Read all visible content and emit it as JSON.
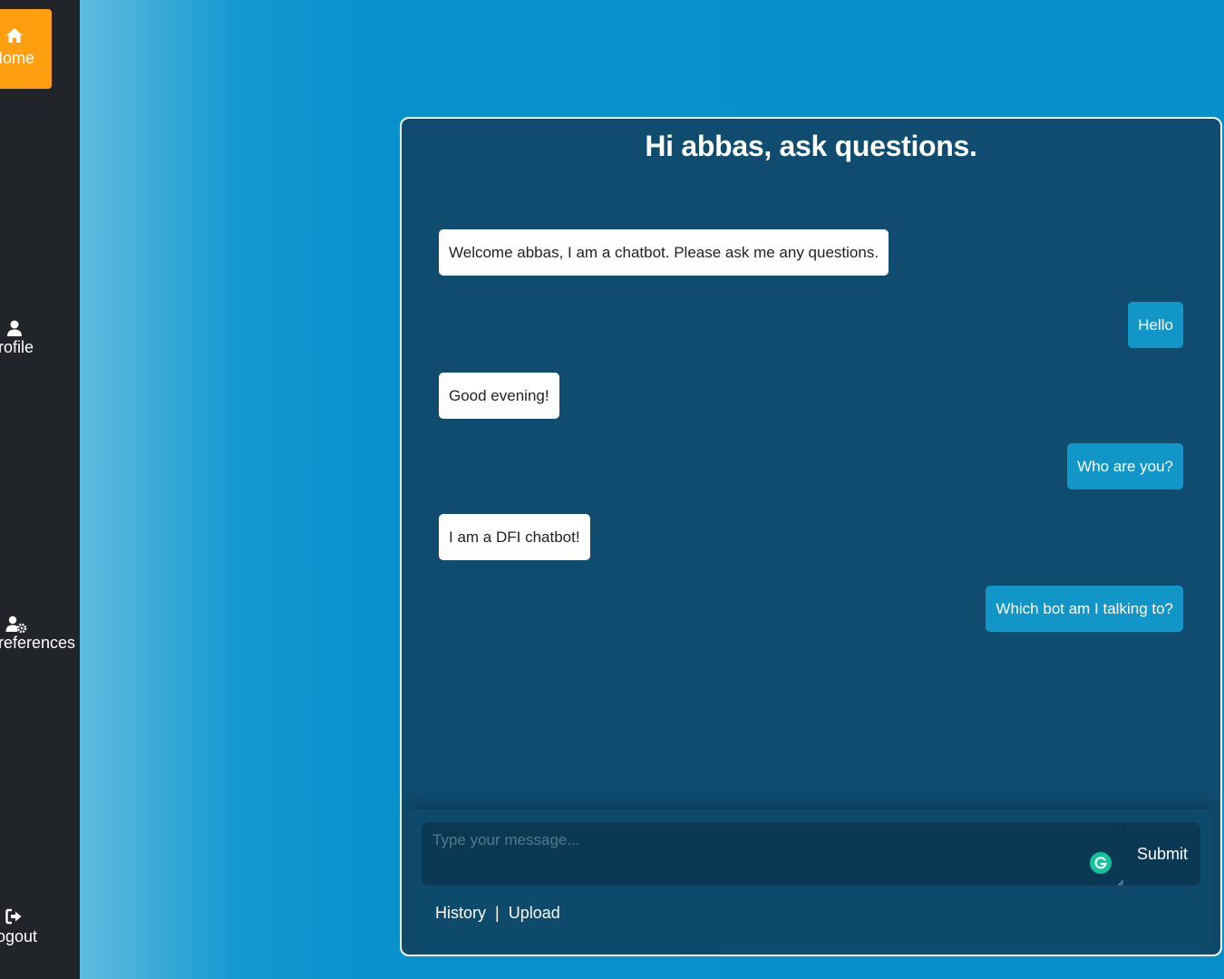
{
  "sidebar": {
    "items": [
      {
        "label": "Home",
        "icon": "home-icon",
        "active": true
      },
      {
        "label": "Profile",
        "icon": "user-icon"
      },
      {
        "label": "Preferences",
        "icon": "user-gear-icon"
      },
      {
        "label": "Logout",
        "icon": "sign-out-icon"
      }
    ]
  },
  "chat": {
    "title": "Hi abbas, ask questions.",
    "messages": [
      {
        "sender": "bot",
        "text": "Welcome abbas, I am a chatbot. Please ask me any questions."
      },
      {
        "sender": "user",
        "text": "Hello"
      },
      {
        "sender": "bot",
        "text": "Good evening!"
      },
      {
        "sender": "user",
        "text": "Who are you?"
      },
      {
        "sender": "bot",
        "text": "I am a DFI chatbot!"
      },
      {
        "sender": "user",
        "text": "Which bot am I talking to?"
      }
    ],
    "input": {
      "placeholder": "Type your message...",
      "value": ""
    },
    "submit_label": "Submit",
    "links": {
      "history": "History",
      "separator": "|",
      "upload": "Upload"
    }
  },
  "colors": {
    "sidebar_bg": "#212529",
    "active_nav": "#ff9f0f",
    "page_bg": "#0890cc",
    "chat_bg": "#0f4c6f",
    "bot_bubble": "#ffffff",
    "user_bubble": "#1196c7"
  }
}
